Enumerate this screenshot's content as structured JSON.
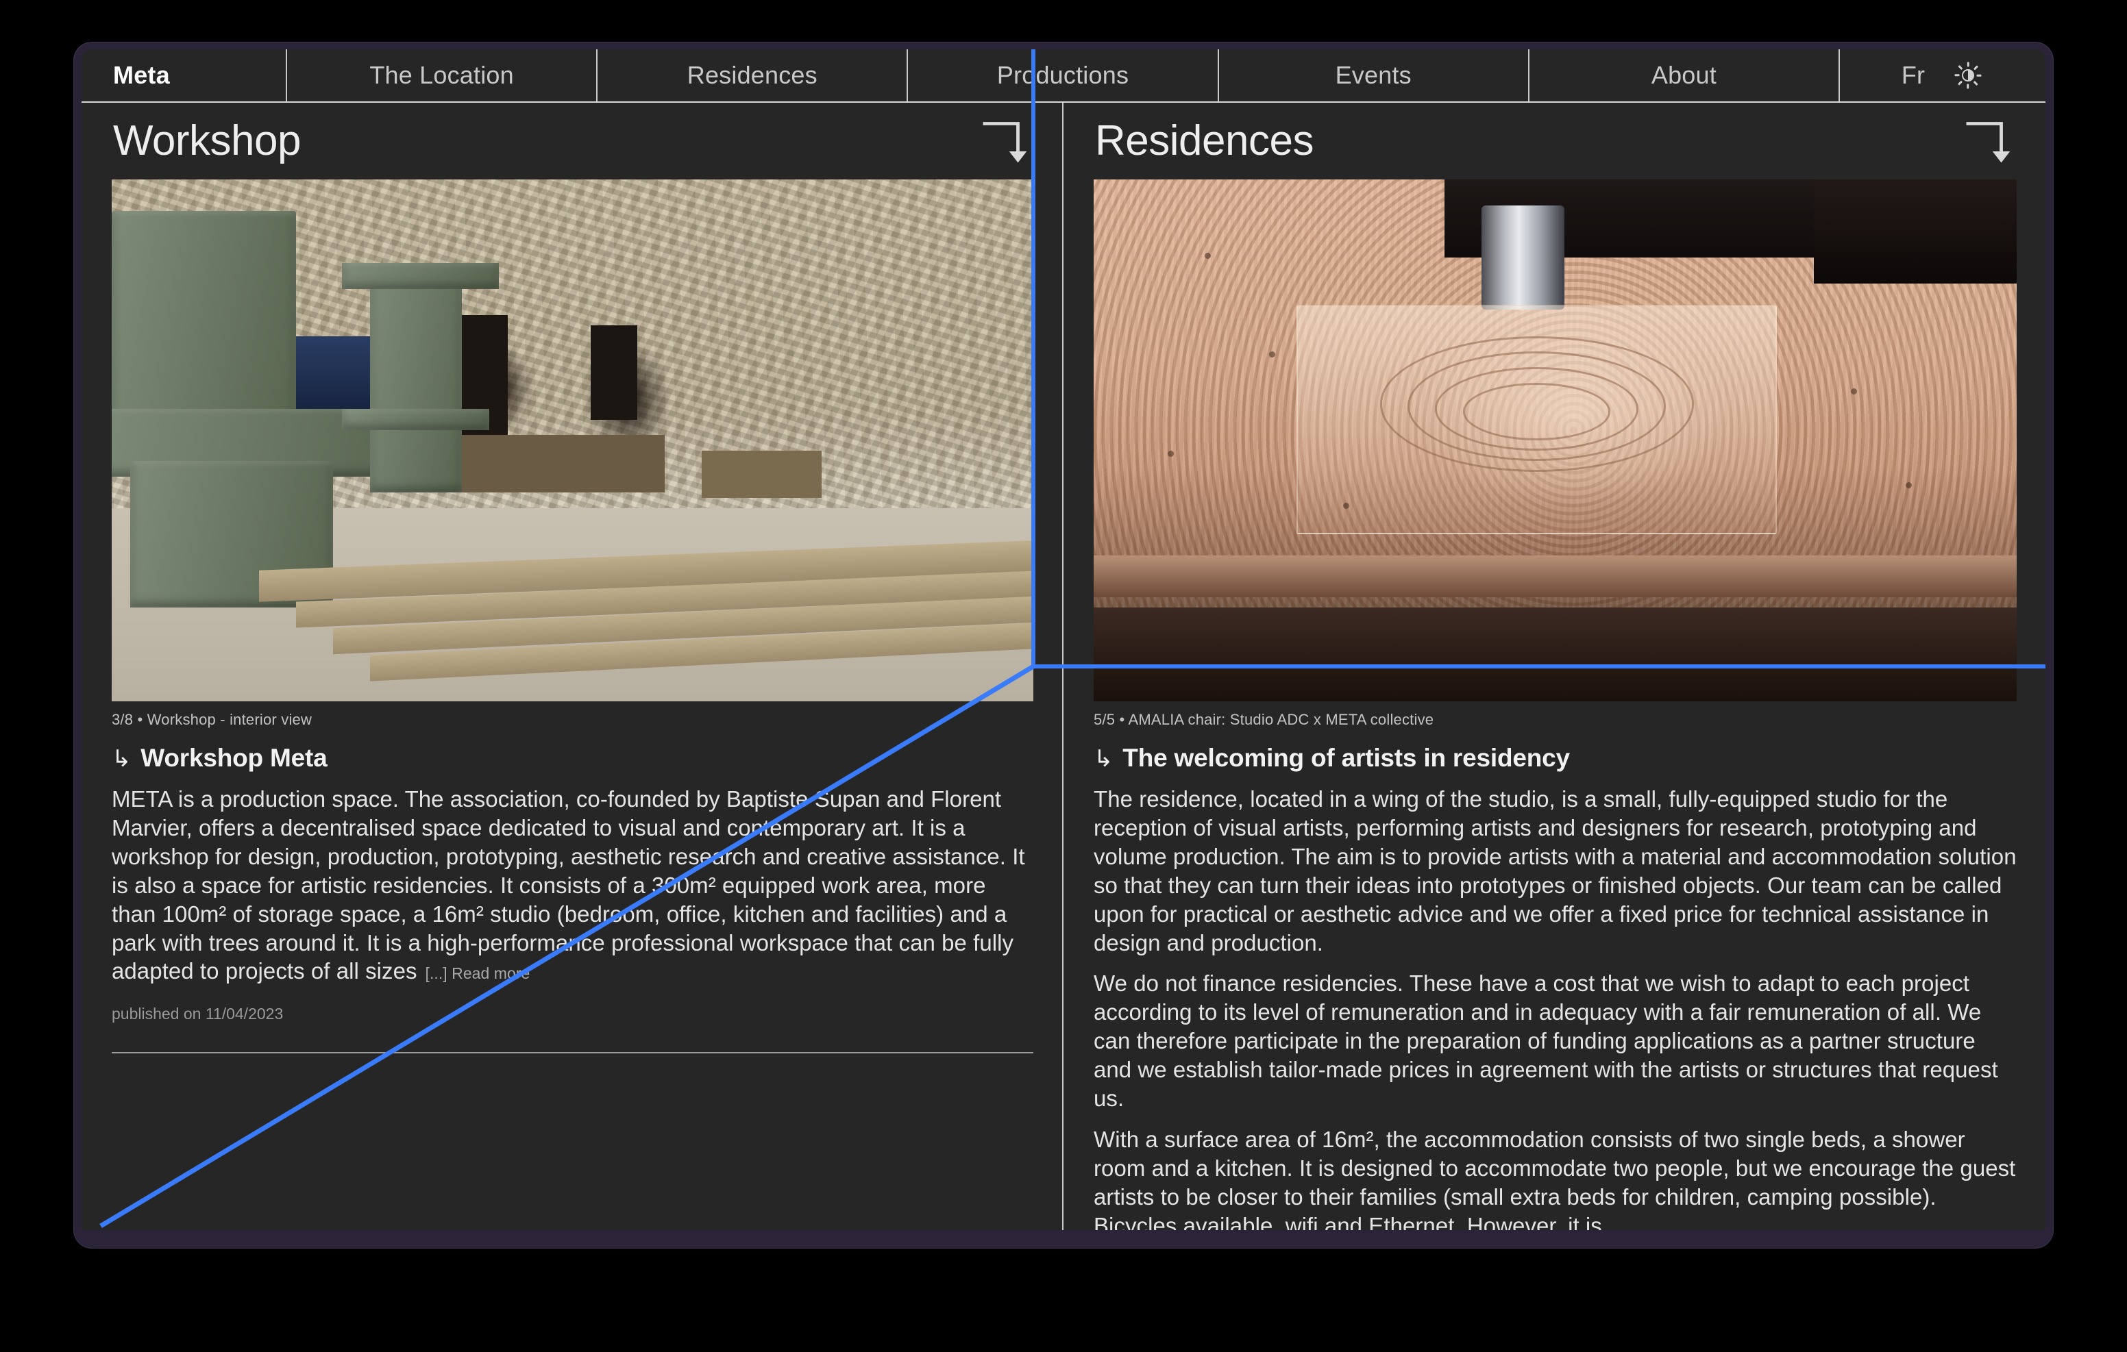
{
  "nav": {
    "tabs": [
      {
        "label": "Meta",
        "active": true
      },
      {
        "label": "The Location",
        "active": false
      },
      {
        "label": "Residences",
        "active": false
      },
      {
        "label": "Productions",
        "active": false
      },
      {
        "label": "Events",
        "active": false
      },
      {
        "label": "About",
        "active": false
      }
    ],
    "language": "Fr",
    "theme_icon": "sun-brightness-icon"
  },
  "left_column": {
    "title": "Workshop",
    "corner_icon": "arrow-turn-down-icon",
    "image_caption": "3/8 • Workshop - interior view",
    "entry_hook": "↳",
    "entry_title": "Workshop Meta",
    "paragraphs": [
      "META is a production space. The association, co-founded by Baptiste Supan and Florent Marvier, offers a decentralised space dedicated to visual and contemporary art. It is a workshop for design, production, prototyping, aesthetic research and creative assistance. It is also a space for artistic residencies. It consists of a 300m² equipped work area, more than 100m² of storage space, a 16m² studio (bedroom, office, kitchen and facilities) and a park with trees around it. It is a high-performance professional workspace that can be fully adapted to projects of all sizes"
    ],
    "read_more": "[...] Read more",
    "published": "published on 11/04/2023"
  },
  "right_column": {
    "title": "Residences",
    "corner_icon": "arrow-turn-down-icon",
    "image_caption": "5/5 • AMALIA chair: Studio ADC x META collective",
    "entry_hook": "↳",
    "entry_title": "The welcoming of artists in residency",
    "paragraphs": [
      "The residence, located in a wing of the studio, is a small, fully-equipped studio for the reception of visual artists, performing artists and designers for research, prototyping and volume production. The aim is to provide artists with a material and accommodation solution so that they can turn their ideas into prototypes or finished objects. Our team can be called upon for practical or aesthetic advice and we offer a fixed price for technical assistance in design and production.",
      "We do not finance residencies. These have a cost that we wish to adapt to each project according to its level of remuneration and in adequacy with a fair remuneration of all. We can therefore participate in the preparation of funding applications as a partner structure and we establish tailor-made prices in agreement with the artists or structures that request us.",
      "With a surface area of 16m², the accommodation consists of two single beds, a shower room and a kitchen. It is designed to accommodate two people, but we encourage the guest artists to be closer to their families (small extra beds for children, camping possible). Bicycles available, wifi and Ethernet. However, it is"
    ]
  },
  "colors": {
    "background": "#000000",
    "window_frame": "#2b2438",
    "surface": "#262626",
    "text_primary": "#eeeeee",
    "text_secondary": "#b0b0b0",
    "rule": "#c9c9c9",
    "crosshair_blue": "#3a7bfa"
  }
}
